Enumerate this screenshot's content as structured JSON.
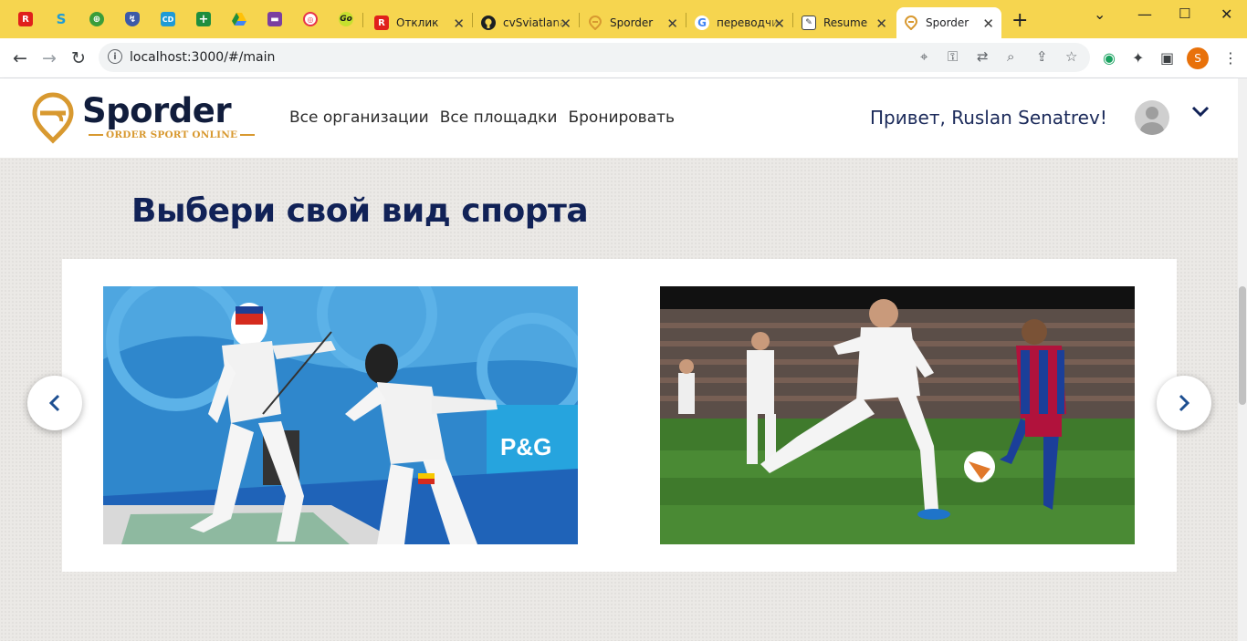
{
  "browser": {
    "tabs": [
      {
        "title": "Отклик",
        "favicon": "r-red-icon"
      },
      {
        "title": "cvSviatlana",
        "favicon": "github-icon"
      },
      {
        "title": "Sporder",
        "favicon": "sporder-icon"
      },
      {
        "title": "переводчик",
        "favicon": "google-icon"
      },
      {
        "title": "Resume",
        "favicon": "notepad-icon"
      },
      {
        "title": "Sporder",
        "favicon": "sporder-icon",
        "active": true
      }
    ],
    "url": "localhost:3000/#/main",
    "profile_initial": "S"
  },
  "header": {
    "logo_text": "Sporder",
    "logo_tagline": "ORDER SPORT ONLINE",
    "nav": [
      {
        "label": "Все организации"
      },
      {
        "label": "Все площадки"
      },
      {
        "label": "Бронировать"
      }
    ],
    "greeting": "Привет, Ruslan Senatrev!"
  },
  "main": {
    "heading": "Выбери свой вид спорта",
    "slides": [
      {
        "sport": "fencing",
        "image_text": "P&G"
      },
      {
        "sport": "football"
      }
    ]
  },
  "colors": {
    "tabstrip": "#f6d54f",
    "brand_navy": "#112257",
    "brand_gold": "#d89930",
    "page_bg": "#ebe9e6"
  }
}
